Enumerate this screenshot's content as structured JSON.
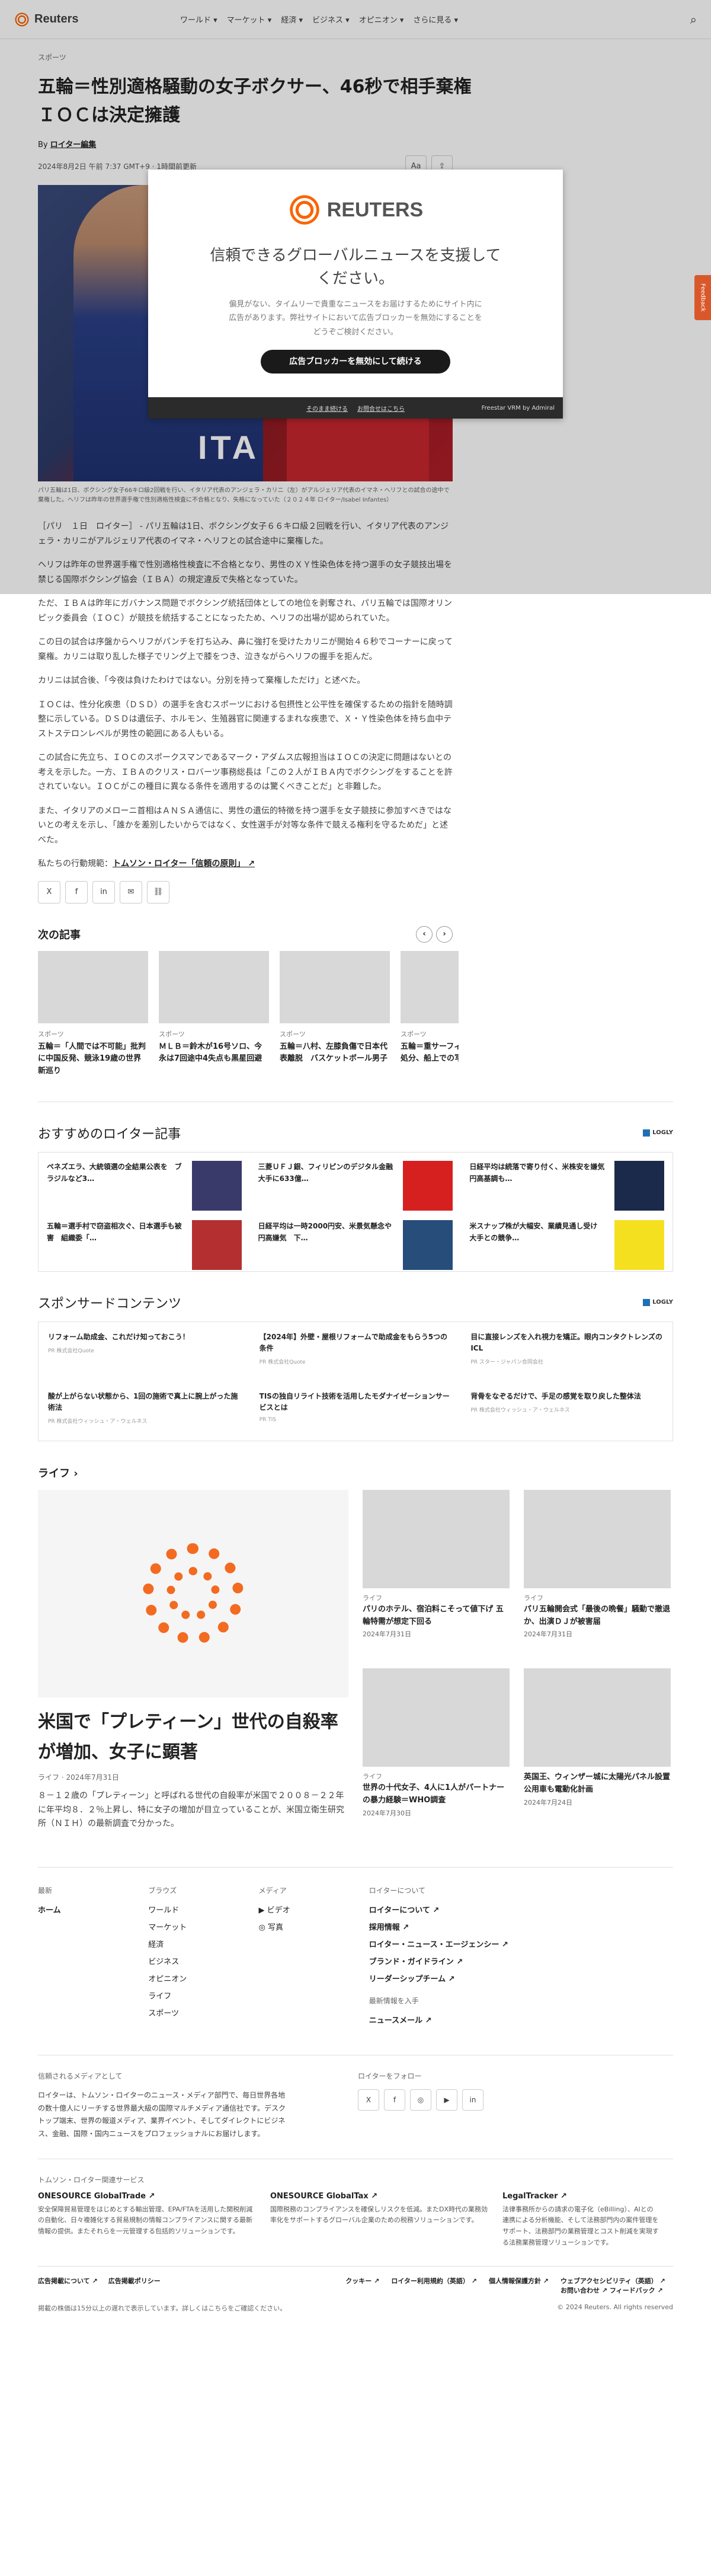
{
  "header": {
    "logo": "Reuters",
    "nav": [
      "ワールド ▾",
      "マーケット ▾",
      "経済 ▾",
      "ビジネス ▾",
      "オピニオン ▾",
      "さらに見る ▾"
    ]
  },
  "article": {
    "kicker": "スポーツ",
    "title": "五輪＝性別適格騒動の女子ボクサー、46秒で相手棄権　ＩＯＣは決定擁護",
    "byline_prefix": "By ",
    "byline_author": "ロイター編集",
    "date": "2024年8月2日 午前 7:37 GMT+9 · 1時間前更新",
    "font_btn": "Aa",
    "share_btn": "⇪",
    "hero_text": "ITA",
    "caption": "パリ五輪は1日、ボクシング女子66キロ級2回戦を行い、イタリア代表のアンジェラ・カリニ（左）がアルジェリア代表のイマネ・ヘリフとの試合の途中で棄権した。ヘリフは昨年の世界選手権で性別適格性検査に不合格となり、失格になっていた（２０２４年 ロイター/Isabel Infantes）",
    "paragraphs": [
      "［パリ　１日　ロイター］ - パリ五輪は1日、ボクシング女子６６キロ級２回戦を行い、イタリア代表のアンジェラ・カリニがアルジェリア代表のイマネ・ヘリフとの試合途中に棄権した。",
      "ヘリフは昨年の世界選手権で性別適格性検査に不合格となり、男性のＸＹ性染色体を持つ選手の女子競技出場を禁じる国際ボクシング協会（ＩＢＡ）の規定違反で失格となっていた。",
      "ただ、ＩＢＡは昨年にガバナンス問題でボクシング統括団体としての地位を剥奪され、パリ五輪では国際オリンピック委員会（ＩＯＣ）が競技を統括することになったため、ヘリフの出場が認められていた。",
      "この日の試合は序盤からヘリフがパンチを打ち込み、鼻に強打を受けたカリニが開始４６秒でコーナーに戻って棄権。カリニは取り乱した様子でリング上で膝をつき、泣きながらヘリフの握手を拒んだ。",
      "カリニは試合後、「今夜は負けたわけではない。分別を持って棄権しただけ」と述べた。",
      "ＩＯＣは、性分化疾患（ＤＳＤ）の選手を含むスポーツにおける包摂性と公平性を確保するための指針を随時調整に示している。ＤＳＤは遺伝子、ホルモン、生殖器官に関連するまれな疾患で、Ｘ・Ｙ性染色体を持ち血中テストステロンレベルが男性の範囲にある人もいる。",
      "この試合に先立ち、ＩＯＣのスポークスマンであるマーク・アダムス広報担当はＩＯＣの決定に問題はないとの考えを示した。一方、ＩＢＡのクリス・ロバーツ事務総長は「この２人がＩＢＡ内でボクシングをすることを許されていない。ＩＯＣがこの種目に異なる条件を適用するのは驚くべきことだ」と非難した。",
      "また、イタリアのメローニ首相はＡＮＳＡ通信に、男性の遺伝的特徴を持つ選手を女子競技に参加すべきではないとの考えを示し、「誰かを差別したいからではなく、女性選手が対等な条件で競える権利を守るためだ」と述べた。"
    ],
    "principles_prefix": "私たちの行動規範：",
    "principles_link": "トムソン・ロイター「信頼の原則」 ↗",
    "share_icons": [
      "X",
      "f",
      "in",
      "✉",
      "⛓"
    ]
  },
  "next": {
    "title": "次の記事",
    "prev": "‹",
    "next": "›",
    "items": [
      {
        "k": "スポーツ",
        "t": "五輪＝「人間では不可能」批判に中国反発、競泳19歳の世界新巡り"
      },
      {
        "k": "スポーツ",
        "t": "ＭＬＢ＝鈴木が16号ソロ、今永は7回途中4失点も黒星回避"
      },
      {
        "k": "スポーツ",
        "t": "五輪＝八村、左膝負傷で日本代表離脱　バスケットボール男子"
      },
      {
        "k": "スポーツ",
        "t": "五輪＝重サーフィン選手を除外処分、船上での写真拡散で"
      }
    ]
  },
  "recommend": {
    "title": "おすすめのロイター記事",
    "badge": "LOGLY",
    "items": [
      {
        "t": "ペネズエラ、大統領選の全結果公表を　ブラジルなど3…",
        "c": "#3a3a6a"
      },
      {
        "t": "三菱ＵＦＪ銀、フィリピンのデジタル金融大手に633億…",
        "c": "#d62020"
      },
      {
        "t": "日経平均は続落で寄り付く、米株安を嫌気　円高基調も…",
        "c": "#1b2a4a"
      },
      {
        "t": "五輪＝選手村で窃盗相次ぐ、日本選手も被害　組織委「…",
        "c": "#b43030"
      },
      {
        "t": "日経平均は一時2000円安、米景気懸念や円高嫌気　下…",
        "c": "#274d7a"
      },
      {
        "t": "米スナップ株が大幅安、業績見通し受け　大手との競争…",
        "c": "#f5e020"
      }
    ]
  },
  "sponsored": {
    "title": "スポンサードコンテンツ",
    "badge": "LOGLY",
    "items": [
      {
        "t": "リフォーム助成金、これだけ知っておこう！",
        "s": "PR 株式会社Quote"
      },
      {
        "t": "【2024年】外壁・屋根リフォームで助成金をもらう5つの条件",
        "s": "PR 株式会社Quote"
      },
      {
        "t": "目に直接レンズを入れ視力を矯正。眼内コンタクトレンズのICL",
        "s": "PR スター・ジャパン合同会社"
      },
      {
        "t": "酸が上がらない状態から、1回の施術で真上に腕上がった施術法",
        "s": "PR 株式会社ウィッシュ・ア・ウェルネス"
      },
      {
        "t": "TISの独自リライト技術を活用したモダナイゼーションサービスとは",
        "s": "PR TIS"
      },
      {
        "t": "背骨をなぞるだけで、手足の感覚を取り戻した整体法",
        "s": "PR 株式会社ウィッシュ・ア・ウェルネス"
      }
    ]
  },
  "life": {
    "title": "ライフ ›",
    "main": {
      "t": "米国で「プレティーン」世代の自殺率が増加、女子に顕著",
      "d": "ライフ · 2024年7月31日",
      "p": "８－１２歳の「プレティーン」と呼ばれる世代の自殺率が米国で２００８－２２年に年平均８．２％上昇し、特に女子の増加が目立っていることが、米国立衛生研究所（ＮＩＨ）の最新調査で分かった。"
    },
    "items": [
      {
        "k": "ライフ",
        "t": "パリのホテル、宿泊料こそって値下げ 五輪特需が想定下回る",
        "d": "2024年7月31日"
      },
      {
        "k": "ライフ",
        "t": "パリ五輪開会式「最後の晩餐」騒動で撤退か、出演ＤＪが被害届",
        "d": "2024年7月31日"
      },
      {
        "k": "ライフ",
        "t": "世界の十代女子、4人に1人がパートナーの暴力経験＝WHO調査",
        "d": "2024年7月30日"
      },
      {
        "k": "",
        "t": "英国王、ウィンザー城に太陽光パネル設置　公用車も電動化計画",
        "d": "2024年7月24日"
      }
    ]
  },
  "footer": {
    "col1": {
      "h": "最新",
      "items": [
        "ホーム"
      ]
    },
    "col2": {
      "h": "ブラウズ",
      "items": [
        "ワールド",
        "マーケット",
        "経済",
        "ビジネス",
        "オピニオン",
        "ライフ",
        "スポーツ"
      ]
    },
    "col3": {
      "h": "メディア",
      "items": [
        "▶ ビデオ",
        "◎ 写真"
      ]
    },
    "col4": {
      "h": "ロイターについて",
      "items": [
        "ロイターについて ↗",
        "採用情報 ↗",
        "ロイター・ニュース・エージェンシー ↗",
        "ブランド・ガイドライン ↗",
        "リーダーシップチーム ↗"
      ],
      "h2": "最新情報を入手",
      "items2": [
        "ニュースメール ↗"
      ]
    },
    "about_h": "信頼されるメディアとして",
    "about_p": "ロイターは、トムソン・ロイターのニュース・メディア部門で、毎日世界各地の数十億人にリーチする世界最大級の国際マルチメディア通信社です。デスクトップ端末、世界の報道メディア、業界イベント、そしてダイレクトにビジネス、金融、国際・国内ニュースをプロフェッショナルにお届けします。",
    "follow_h": "ロイターをフォロー",
    "follow": [
      "X",
      "f",
      "◎",
      "▶",
      "in"
    ],
    "svc_h": "トムソン・ロイター関連サービス",
    "svc": [
      {
        "b": "ONESOURCE GlobalTrade ↗",
        "p": "安全保障貿易管理をはじめとする輸出管理、EPA/FTAを活用した関税削減の自動化、日々複雑化する貿易規制の情報コンプライアンスに関する最新情報の提供。またそれらを一元管理する包括的ソリューションです。"
      },
      {
        "b": "ONESOURCE GlobalTax ↗",
        "p": "国際税務のコンプライアンスを確保しリスクを低減。またDX時代の業務効率化をサポートするグローバル企業のための税務ソリューションです。"
      },
      {
        "b": "LegalTracker ↗",
        "p": "法律事務所からの請求の電子化（eBilling）、AIとの連携による分析機能、そして法務部門内の案件管理をサポート、法務部門の業務管理とコスト削減を実現する法務業務管理ソリューションです。"
      }
    ],
    "legal_l": [
      "広告掲載について ↗",
      "広告掲載ポリシー"
    ],
    "legal_r": [
      "クッキー ↗",
      "ロイター利用規約（英語） ↗",
      "個人情報保護方針 ↗",
      "ウェブアクセシビリティ（英語） ↗ お問い合わせ ↗  フィードバック ↗"
    ],
    "delay": "掲載の株価は15分以上の遅れで表示しています。詳しくはこちらをご確認ください。",
    "copyright": "© 2024 Reuters. All rights reserved"
  },
  "modal": {
    "logo": "REUTERS",
    "title": "信頼できるグローバルニュースを支援してください。",
    "body": "偏見がない、タイムリーで貴重なニュースをお届けするためにサイト内に広告があります。弊社サイトにおいて広告ブロッカーを無効にすることをどうぞご検討ください。",
    "cta": "広告ブロッカーを無効にして続ける",
    "continue": "そのまま続ける",
    "help": "お問合せはこちら",
    "vendor": "Freestar VRM  by Admiral"
  },
  "feedback": "Feedback"
}
